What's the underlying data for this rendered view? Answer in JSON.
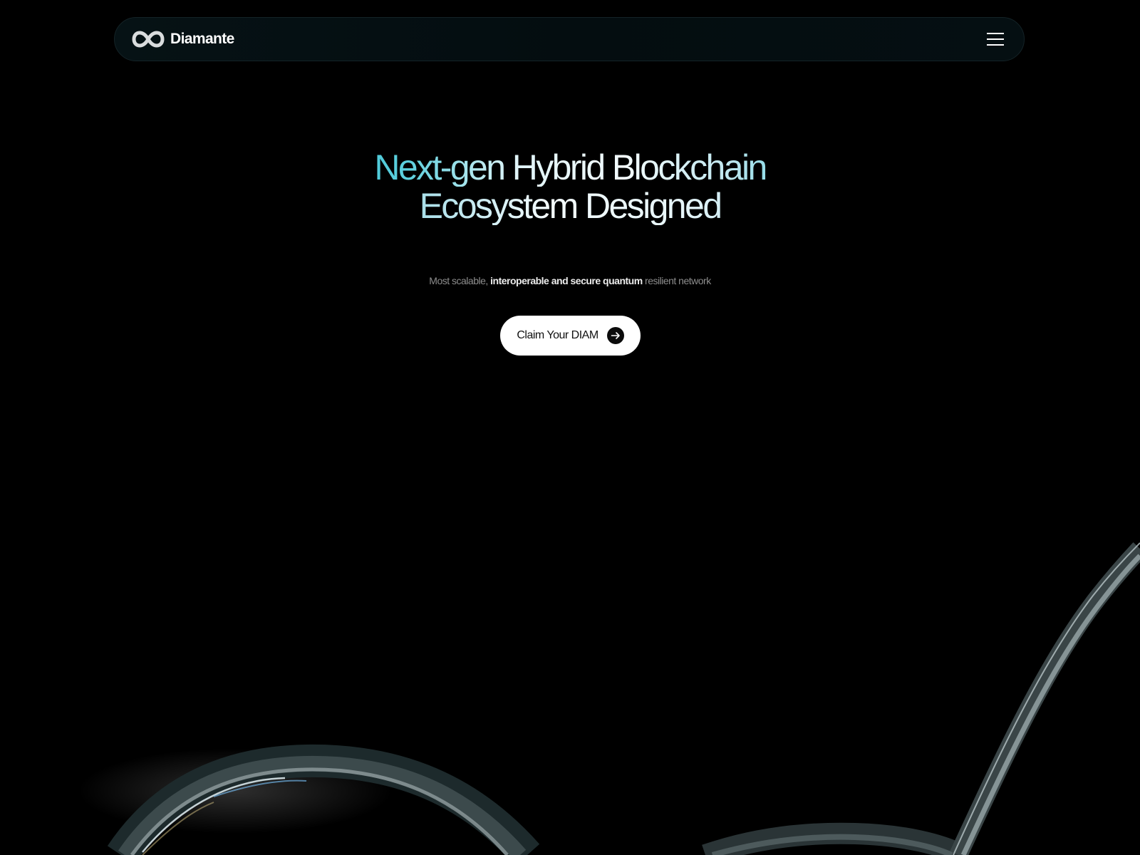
{
  "header": {
    "brand_name": "Diamante",
    "logo_icon": "infinity-logo-icon",
    "menu_icon": "hamburger-menu-icon"
  },
  "hero": {
    "title_line_1": "Next-gen Hybrid Blockchain",
    "title_line_2": "Ecosystem Designed",
    "subtitle": {
      "part_1": "Most scalable, ",
      "part_2": "interoperable and secure quantum",
      "part_3": " resilient network"
    },
    "cta_label": "Claim Your DIAM",
    "cta_icon": "arrow-right-icon"
  },
  "colors": {
    "background": "#000000",
    "accent_cyan": "#27bfd0",
    "cta_background": "#ffffff",
    "cta_text": "#111111"
  }
}
